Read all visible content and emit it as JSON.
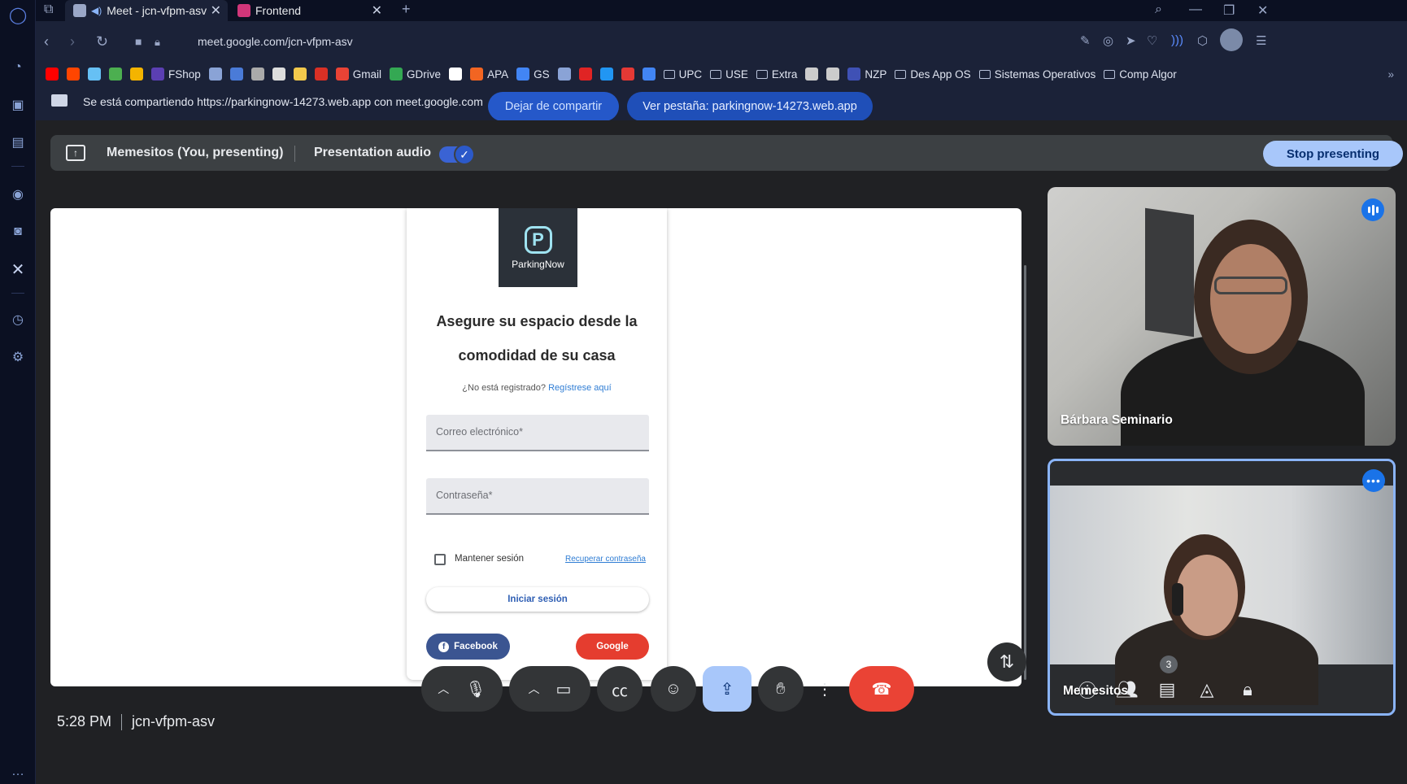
{
  "browser": {
    "tabs": [
      {
        "label": "Meet - jcn-vfpm-asv",
        "active": true
      },
      {
        "label": "Frontend",
        "active": false
      }
    ],
    "new_tab_icon": "+",
    "url": "meet.google.com/jcn-vfpm-asv",
    "bookmarks": [
      {
        "label": "",
        "icon": "youtube",
        "color": "#ff0000"
      },
      {
        "label": "",
        "icon": "reddit",
        "color": "#ff4500"
      },
      {
        "label": "",
        "icon": "steam",
        "color": "#66c0f4"
      },
      {
        "label": "",
        "icon": "chrome",
        "color": "#4caf50"
      },
      {
        "label": "",
        "icon": "emoji",
        "color": "#f4b400"
      },
      {
        "label": "FShop",
        "icon": "fshop",
        "color": "#5b3fb3"
      },
      {
        "label": "",
        "icon": "bookmark",
        "color": "#8aa3d6"
      },
      {
        "label": "",
        "icon": "bookmark",
        "color": "#4a7bd8"
      },
      {
        "label": "",
        "icon": "item",
        "color": "#aaaaaa"
      },
      {
        "label": "",
        "icon": "roblox",
        "color": "#dddddd"
      },
      {
        "label": "",
        "icon": "pen",
        "color": "#f2c94c"
      },
      {
        "label": "",
        "icon": "v",
        "color": "#d93025"
      },
      {
        "label": "Gmail",
        "icon": "gmail",
        "color": "#ea4335"
      },
      {
        "label": "GDrive",
        "icon": "gdrive",
        "color": "#34a853"
      },
      {
        "label": "",
        "icon": "amazon",
        "color": "#ffffff"
      },
      {
        "label": "APA",
        "icon": "apa",
        "color": "#f26522"
      },
      {
        "label": "GS",
        "icon": "gs",
        "color": "#4285f4"
      },
      {
        "label": "",
        "icon": "arrow",
        "color": "#8aa3d6"
      },
      {
        "label": "",
        "icon": "sy",
        "color": "#e02424"
      },
      {
        "label": "",
        "icon": "x",
        "color": "#2196f3"
      },
      {
        "label": "",
        "icon": "heart",
        "color": "#e53935"
      },
      {
        "label": "",
        "icon": "diamond",
        "color": "#4285f4"
      },
      {
        "label": "UPC",
        "icon": "folder"
      },
      {
        "label": "USE",
        "icon": "folder"
      },
      {
        "label": "Extra",
        "icon": "folder"
      },
      {
        "label": "",
        "icon": "face",
        "color": "#cccccc"
      },
      {
        "label": "",
        "icon": "filter",
        "color": "#cccccc"
      },
      {
        "label": "NZP",
        "icon": "nzp",
        "color": "#3f51b5"
      },
      {
        "label": "Des App OS",
        "icon": "folder"
      },
      {
        "label": "Sistemas Operativos",
        "icon": "folder"
      },
      {
        "label": "Comp Algor",
        "icon": "folder"
      }
    ],
    "sharing_bar": {
      "message": "Se está compartiendo https://parkingnow-14273.web.app con meet.google.com",
      "stop_button": "Dejar de compartir",
      "view_tab_button": "Ver pestaña: parkingnow-14273.web.app"
    }
  },
  "meet": {
    "presenting_label": "Memesitos (You, presenting)",
    "audio_label": "Presentation audio",
    "audio_enabled": true,
    "stop_presenting": "Stop presenting",
    "time": "5:28 PM",
    "meeting_code": "jcn-vfpm-asv",
    "participant_count": "3",
    "participants": [
      {
        "name": "Bárbara Seminario",
        "speaking": true
      },
      {
        "name": "Memesitos",
        "speaking": false
      }
    ],
    "colors": {
      "accent": "#a8c7fa",
      "hangup": "#ea4335",
      "tile_border": "#8ab4f8"
    }
  },
  "shared_page": {
    "logo_text": "ParkingNow",
    "headline_line1": "Asegure su espacio desde la",
    "headline_line2": "comodidad de su casa",
    "not_registered": "¿No está registrado?",
    "register_link": "Regístrese aquí",
    "email_placeholder": "Correo electrónico*",
    "password_placeholder": "Contraseña*",
    "keep_session": "Mantener sesión",
    "recover_password": "Recuperar contraseña",
    "login_button": "Iniciar sesión",
    "facebook_button": "Facebook",
    "google_button": "Google"
  }
}
